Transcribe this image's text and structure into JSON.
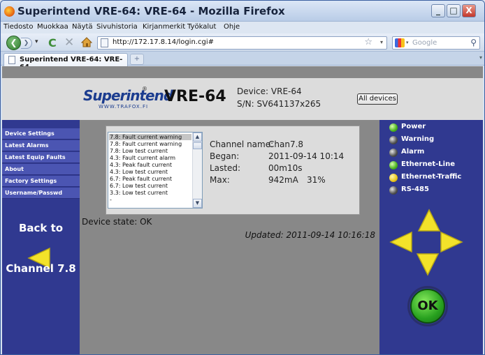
{
  "window": {
    "title": "Superintend VRE-64: VRE-64 - Mozilla Firefox",
    "controls": {
      "minimize": "_",
      "maximize": "□",
      "close": "X"
    }
  },
  "menu": [
    "Tiedosto",
    "Muokkaa",
    "Näytä",
    "Sivuhistoria",
    "Kirjanmerkit",
    "Työkalut",
    "Ohje"
  ],
  "navbar": {
    "url": "http://172.17.8.14/login.cgi#",
    "search_placeholder": "Google"
  },
  "tabs": [
    {
      "label": "Superintend VRE-64: VRE-64"
    }
  ],
  "tab_new": "+",
  "page": {
    "logo": {
      "name": "Superintend",
      "reg": "®",
      "sub": "WWW.TRAFOX.FI"
    },
    "model": "VRE-64",
    "device_line": "Device: VRE-64",
    "sn_line": "S/N: SV641137x265",
    "all_devices_label": "All devices",
    "sidebar_links": [
      "Device Settings",
      "Latest Alarms",
      "Latest Equip Faults",
      "About",
      "Factory Settings",
      "Username/Passwd"
    ],
    "back_to_label": "Back to",
    "channel_label": "Channel 7.8",
    "fault_list": [
      "7.8: Fault current warning",
      "7.8: Fault current warning",
      "7.8: Low test current",
      "4.3: Fault current alarm",
      "4.3: Peak fault current",
      "4.3: Low test current",
      "6.7: Peak fault current",
      "6.7: Low test current",
      "3.3: Low test current",
      "-"
    ],
    "details": {
      "channel_name_label": "Channel name:",
      "channel_name": "Chan7.8",
      "began_label": "Began:",
      "began": "2011-09-14 10:14",
      "lasted_label": "Lasted:",
      "lasted": "00m10s",
      "max_label": "Max:",
      "max_current": "942mA",
      "max_percent": "31%"
    },
    "device_state": "Device state:  OK",
    "updated": "Updated: 2011-09-14 10:16:18",
    "status_leds": [
      {
        "label": "Power",
        "color": "green"
      },
      {
        "label": "Warning",
        "color": "gray"
      },
      {
        "label": "Alarm",
        "color": "gray"
      },
      {
        "label": "Ethernet-Line",
        "color": "green"
      },
      {
        "label": "Ethernet-Traffic",
        "color": "yellow"
      },
      {
        "label": "RS-485",
        "color": "gray"
      }
    ],
    "ok_label": "OK"
  },
  "colors": {
    "panel_blue": "#303990",
    "link_blue": "#4b55b2",
    "arrow_yellow": "#f3e22a",
    "header_gray": "#dcdcdc"
  }
}
